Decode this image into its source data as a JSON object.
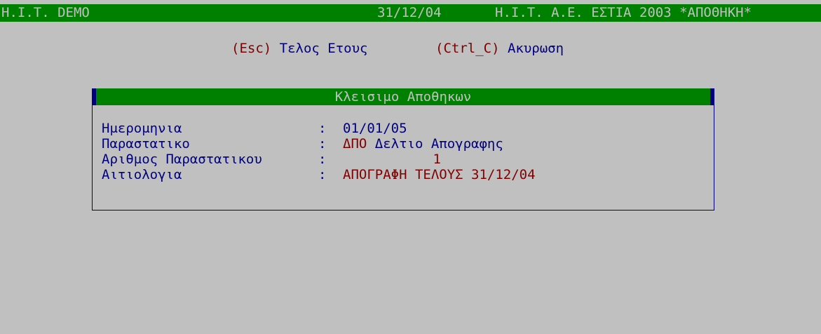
{
  "header": {
    "left": "H.I.T. DEMO",
    "date": "31/12/04",
    "right": "H.I.T. A.E. ΕΣΤΙΑ 2003 *ΑΠΟΘΗΚΗ*"
  },
  "shortcuts": [
    {
      "key": "(Esc)",
      "label": "Τελος Ετους"
    },
    {
      "key": "(Ctrl_C)",
      "label": "Ακυρωση"
    }
  ],
  "dialog": {
    "title": "Κλεισιμο Αποθηκων",
    "fields": [
      {
        "label": "Ημερομηνια",
        "colon": ":",
        "value": "01/01/05"
      },
      {
        "label": "Παραστατικο",
        "colon": ":",
        "code": "ΔΠΟ",
        "value": "Δελτιο Απογραφης"
      },
      {
        "label": "Αριθμος Παραστατικου",
        "colon": ":",
        "value": "1"
      },
      {
        "label": "Αιτιολογια",
        "colon": ":",
        "value": "ΑΠΟΓΡΑΦΗ ΤΕΛΟΥΣ 31/12/04"
      }
    ]
  },
  "colors": {
    "background": "#c0c0c0",
    "bar": "#008000",
    "text": "#000080",
    "accent": "#800000"
  }
}
